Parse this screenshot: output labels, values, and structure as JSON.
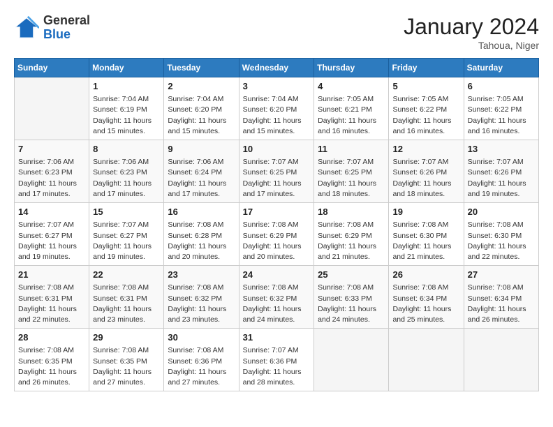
{
  "header": {
    "logo_general": "General",
    "logo_blue": "Blue",
    "month": "January 2024",
    "location": "Tahoua, Niger"
  },
  "days_of_week": [
    "Sunday",
    "Monday",
    "Tuesday",
    "Wednesday",
    "Thursday",
    "Friday",
    "Saturday"
  ],
  "weeks": [
    [
      {
        "day": "",
        "info": ""
      },
      {
        "day": "1",
        "info": "Sunrise: 7:04 AM\nSunset: 6:19 PM\nDaylight: 11 hours\nand 15 minutes."
      },
      {
        "day": "2",
        "info": "Sunrise: 7:04 AM\nSunset: 6:20 PM\nDaylight: 11 hours\nand 15 minutes."
      },
      {
        "day": "3",
        "info": "Sunrise: 7:04 AM\nSunset: 6:20 PM\nDaylight: 11 hours\nand 15 minutes."
      },
      {
        "day": "4",
        "info": "Sunrise: 7:05 AM\nSunset: 6:21 PM\nDaylight: 11 hours\nand 16 minutes."
      },
      {
        "day": "5",
        "info": "Sunrise: 7:05 AM\nSunset: 6:22 PM\nDaylight: 11 hours\nand 16 minutes."
      },
      {
        "day": "6",
        "info": "Sunrise: 7:05 AM\nSunset: 6:22 PM\nDaylight: 11 hours\nand 16 minutes."
      }
    ],
    [
      {
        "day": "7",
        "info": "Sunrise: 7:06 AM\nSunset: 6:23 PM\nDaylight: 11 hours\nand 17 minutes."
      },
      {
        "day": "8",
        "info": "Sunrise: 7:06 AM\nSunset: 6:23 PM\nDaylight: 11 hours\nand 17 minutes."
      },
      {
        "day": "9",
        "info": "Sunrise: 7:06 AM\nSunset: 6:24 PM\nDaylight: 11 hours\nand 17 minutes."
      },
      {
        "day": "10",
        "info": "Sunrise: 7:07 AM\nSunset: 6:25 PM\nDaylight: 11 hours\nand 17 minutes."
      },
      {
        "day": "11",
        "info": "Sunrise: 7:07 AM\nSunset: 6:25 PM\nDaylight: 11 hours\nand 18 minutes."
      },
      {
        "day": "12",
        "info": "Sunrise: 7:07 AM\nSunset: 6:26 PM\nDaylight: 11 hours\nand 18 minutes."
      },
      {
        "day": "13",
        "info": "Sunrise: 7:07 AM\nSunset: 6:26 PM\nDaylight: 11 hours\nand 19 minutes."
      }
    ],
    [
      {
        "day": "14",
        "info": "Sunrise: 7:07 AM\nSunset: 6:27 PM\nDaylight: 11 hours\nand 19 minutes."
      },
      {
        "day": "15",
        "info": "Sunrise: 7:07 AM\nSunset: 6:27 PM\nDaylight: 11 hours\nand 19 minutes."
      },
      {
        "day": "16",
        "info": "Sunrise: 7:08 AM\nSunset: 6:28 PM\nDaylight: 11 hours\nand 20 minutes."
      },
      {
        "day": "17",
        "info": "Sunrise: 7:08 AM\nSunset: 6:29 PM\nDaylight: 11 hours\nand 20 minutes."
      },
      {
        "day": "18",
        "info": "Sunrise: 7:08 AM\nSunset: 6:29 PM\nDaylight: 11 hours\nand 21 minutes."
      },
      {
        "day": "19",
        "info": "Sunrise: 7:08 AM\nSunset: 6:30 PM\nDaylight: 11 hours\nand 21 minutes."
      },
      {
        "day": "20",
        "info": "Sunrise: 7:08 AM\nSunset: 6:30 PM\nDaylight: 11 hours\nand 22 minutes."
      }
    ],
    [
      {
        "day": "21",
        "info": "Sunrise: 7:08 AM\nSunset: 6:31 PM\nDaylight: 11 hours\nand 22 minutes."
      },
      {
        "day": "22",
        "info": "Sunrise: 7:08 AM\nSunset: 6:31 PM\nDaylight: 11 hours\nand 23 minutes."
      },
      {
        "day": "23",
        "info": "Sunrise: 7:08 AM\nSunset: 6:32 PM\nDaylight: 11 hours\nand 23 minutes."
      },
      {
        "day": "24",
        "info": "Sunrise: 7:08 AM\nSunset: 6:32 PM\nDaylight: 11 hours\nand 24 minutes."
      },
      {
        "day": "25",
        "info": "Sunrise: 7:08 AM\nSunset: 6:33 PM\nDaylight: 11 hours\nand 24 minutes."
      },
      {
        "day": "26",
        "info": "Sunrise: 7:08 AM\nSunset: 6:34 PM\nDaylight: 11 hours\nand 25 minutes."
      },
      {
        "day": "27",
        "info": "Sunrise: 7:08 AM\nSunset: 6:34 PM\nDaylight: 11 hours\nand 26 minutes."
      }
    ],
    [
      {
        "day": "28",
        "info": "Sunrise: 7:08 AM\nSunset: 6:35 PM\nDaylight: 11 hours\nand 26 minutes."
      },
      {
        "day": "29",
        "info": "Sunrise: 7:08 AM\nSunset: 6:35 PM\nDaylight: 11 hours\nand 27 minutes."
      },
      {
        "day": "30",
        "info": "Sunrise: 7:08 AM\nSunset: 6:36 PM\nDaylight: 11 hours\nand 27 minutes."
      },
      {
        "day": "31",
        "info": "Sunrise: 7:07 AM\nSunset: 6:36 PM\nDaylight: 11 hours\nand 28 minutes."
      },
      {
        "day": "",
        "info": ""
      },
      {
        "day": "",
        "info": ""
      },
      {
        "day": "",
        "info": ""
      }
    ]
  ]
}
